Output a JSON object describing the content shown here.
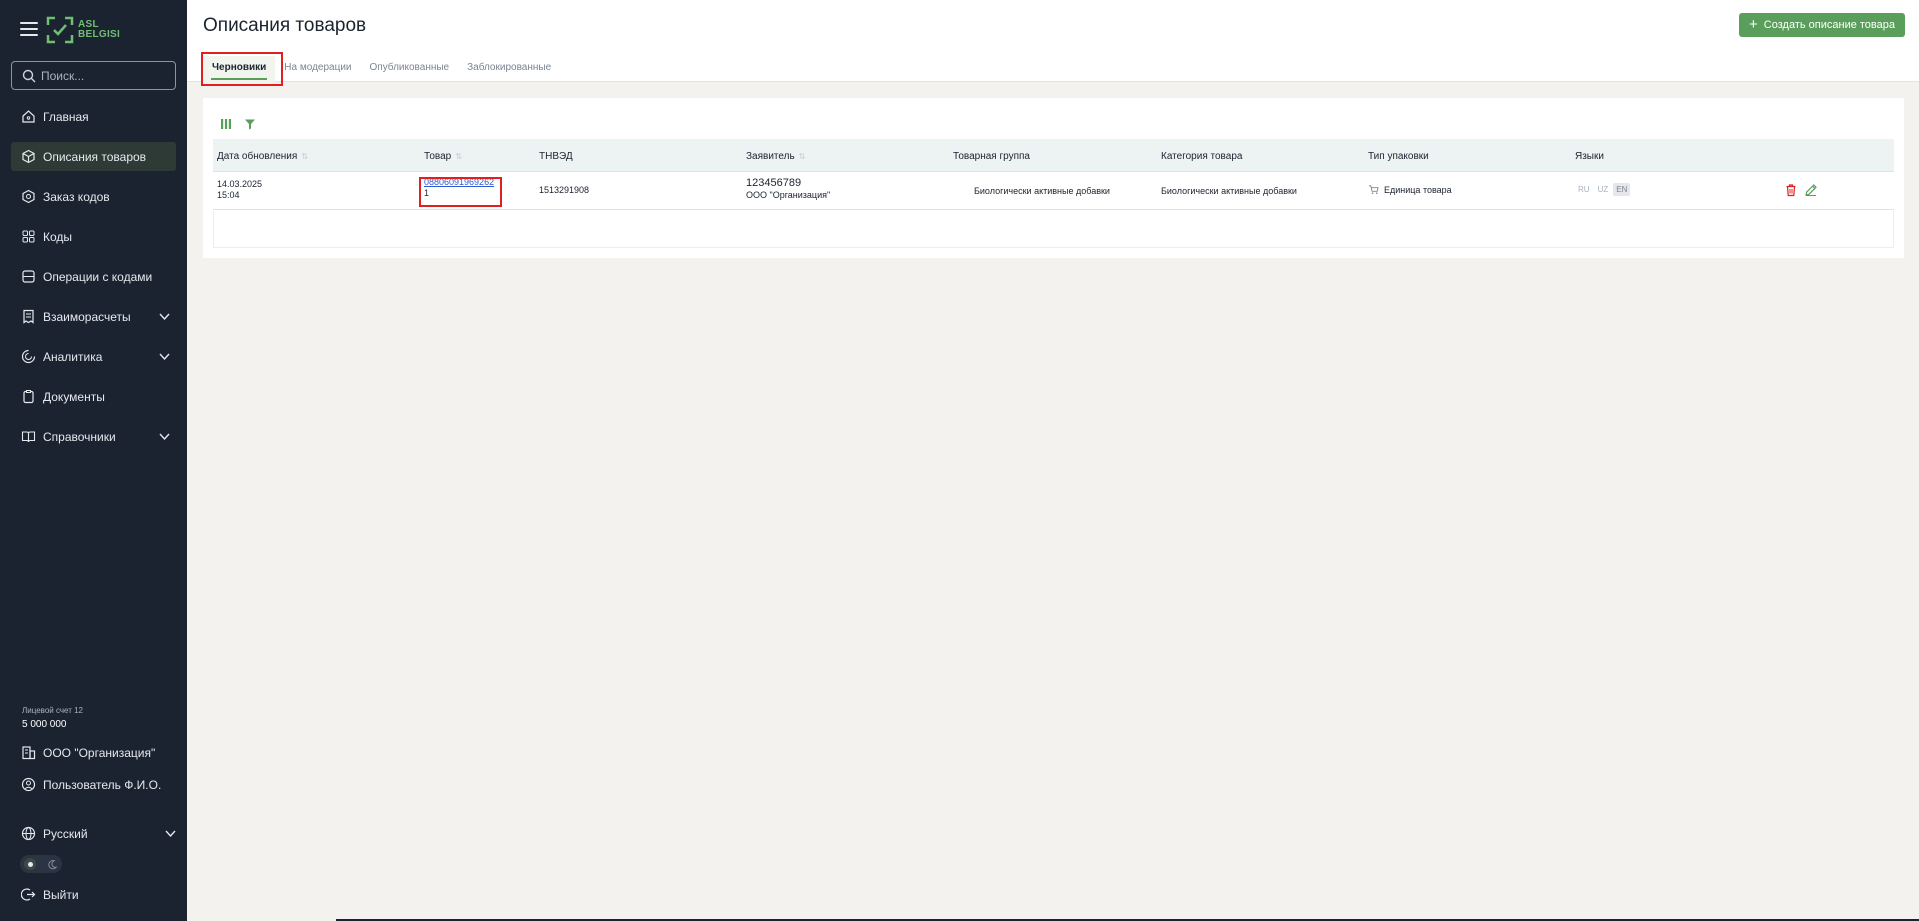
{
  "app": {
    "logo_text": [
      "ASL",
      "BELGISI"
    ],
    "search_placeholder": "Поиск..."
  },
  "sidebar": {
    "items": [
      {
        "label": "Главная",
        "icon": "home-icon"
      },
      {
        "label": "Описания товаров",
        "icon": "box-icon",
        "active": true
      },
      {
        "label": "Заказ кодов",
        "icon": "order-icon"
      },
      {
        "label": "Коды",
        "icon": "qr-icon"
      },
      {
        "label": "Операции с кодами",
        "icon": "operations-icon"
      },
      {
        "label": "Взаиморасчеты",
        "icon": "receipt-icon",
        "expandable": true
      },
      {
        "label": "Аналитика",
        "icon": "analytics-icon",
        "expandable": true
      },
      {
        "label": "Документы",
        "icon": "clipboard-icon"
      },
      {
        "label": "Справочники",
        "icon": "book-icon",
        "expandable": true
      }
    ],
    "account_label": "Лицевой счет 12",
    "account_balance": "5 000 000",
    "organization": "ООО \"Организация\"",
    "user": "Пользователь Ф.И.О.",
    "language": "Русский",
    "logout": "Выйти"
  },
  "header": {
    "title": "Описания товаров",
    "create_button": "Создать описание товара",
    "tabs": [
      "Черновики",
      "На модерации",
      "Опубликованные",
      "Заблокированные"
    ],
    "active_tab": 0
  },
  "table": {
    "columns": [
      "Дата обновления",
      "Товар",
      "ТНВЭД",
      "Заявитель",
      "Товарная группа",
      "Категория товара",
      "Тип упаковки",
      "Языки"
    ],
    "rows": [
      {
        "date": "14.03.2025",
        "time": "15:04",
        "product_code": "08806091969262",
        "product_code_tail": "1",
        "tnved": "1513291908",
        "applicant_inn": "123456789",
        "applicant_name": "ООО \"Организация\"",
        "product_group": "Биологически активные добавки",
        "category": "Биологически активные добавки",
        "package": "Единица товара",
        "languages": [
          "RU",
          "UZ",
          "EN"
        ],
        "selected_language": "EN"
      }
    ]
  },
  "colors": {
    "sidebar_bg": "#1b2330",
    "accent_green": "#5a9e5c",
    "delete_red": "#e02020",
    "highlight": "#e02020"
  }
}
